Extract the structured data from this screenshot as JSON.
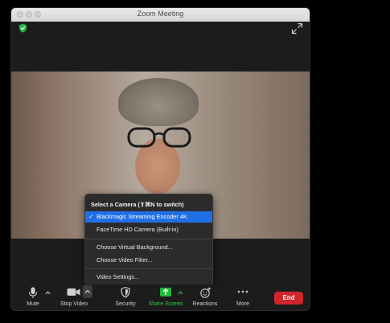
{
  "window": {
    "title": "Zoom Meeting"
  },
  "camera_menu": {
    "heading": "Select a Camera (⇧⌘N to switch)",
    "cameras": [
      {
        "label": "Blackmagic Streaming Encoder 4K",
        "selected": true
      },
      {
        "label": "FaceTime HD Camera (Built-in)",
        "selected": false
      }
    ],
    "options": [
      "Choose Virtual Background...",
      "Choose Video Filter..."
    ],
    "settings": "Video Settings...",
    "check_mark": "✓"
  },
  "toolbar": {
    "mute": "Mute",
    "stop_video": "Stop Video",
    "security": "Security",
    "share_screen": "Share Screen",
    "reactions": "Reactions",
    "more": "More",
    "end": "End"
  },
  "colors": {
    "end": "#d0262a",
    "share_green": "#20b83b",
    "selection_blue": "#1f6fe5",
    "security_badge": "#27b14b"
  }
}
